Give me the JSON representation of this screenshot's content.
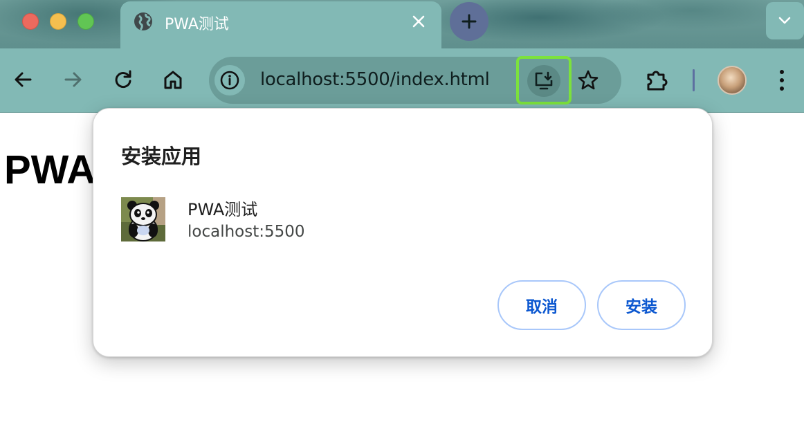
{
  "tab": {
    "title": "PWA测试",
    "favicon": "globe-icon"
  },
  "toolbar": {
    "url": "localhost:5500/index.html",
    "icons": [
      "back-arrow-icon",
      "forward-arrow-icon",
      "reload-icon",
      "home-icon",
      "info-icon",
      "install-app-icon",
      "bookmark-star-icon",
      "extensions-puzzle-icon",
      "kebab-menu-icon"
    ]
  },
  "page": {
    "heading": "PWA"
  },
  "dialog": {
    "title": "安装应用",
    "app_name": "PWA测试",
    "app_origin": "localhost:5500",
    "cancel_label": "取消",
    "install_label": "安装"
  },
  "colors": {
    "tab_active": "#82b9b5",
    "highlight": "#7ce23c",
    "button_text": "#0b57d0",
    "button_border": "#a8c7fa"
  }
}
